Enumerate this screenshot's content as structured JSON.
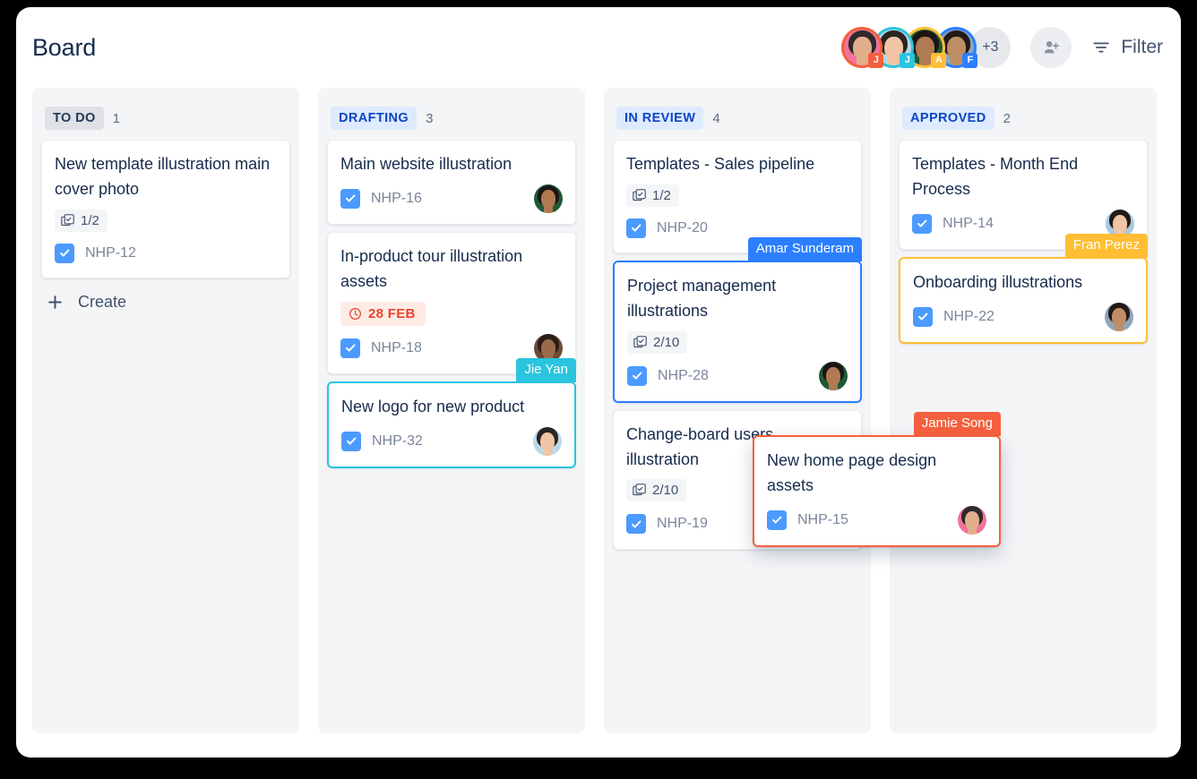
{
  "header": {
    "title": "Board",
    "overflow_count": "+3",
    "filter_label": "Filter",
    "add_person_icon": "person-add-icon",
    "filter_icon": "filter-icon",
    "avatars": [
      {
        "initial": "J",
        "ring": "#F4603E",
        "badge": "#F4603E",
        "hair": "#2E2A29",
        "skin": "#E3AE8C",
        "bg": "#F2739B"
      },
      {
        "initial": "J",
        "ring": "#2BC4DE",
        "badge": "#2BC4DE",
        "hair": "#2B2422",
        "skin": "#F0C4A4",
        "bg": "#BBD8E6"
      },
      {
        "initial": "A",
        "ring": "#FFBE33",
        "badge": "#FFBE33",
        "hair": "#1C1614",
        "skin": "#B07A53",
        "bg": "#1E5B36"
      },
      {
        "initial": "F",
        "ring": "#2B7FFF",
        "badge": "#2B7FFF",
        "hair": "#221A18",
        "skin": "#C08E66",
        "bg": "#8FA5B8"
      }
    ]
  },
  "columns": [
    {
      "name": "TO DO",
      "chip_style": "chip-todo",
      "count": "1",
      "create_label": "Create",
      "cards": [
        {
          "title": "New template illustration main cover photo",
          "subtasks": "1/2",
          "key": "NHP-12",
          "avatar": null,
          "due": null,
          "selection": null,
          "presence": null
        }
      ]
    },
    {
      "name": "DRAFTING",
      "chip_style": "chip-blue",
      "count": "3",
      "create_label": null,
      "cards": [
        {
          "title": "Main website illustration",
          "subtasks": null,
          "key": "NHP-16",
          "avatar": {
            "hair": "#1C1614",
            "skin": "#B07A53",
            "bg": "#1E5B36"
          },
          "due": null,
          "selection": null,
          "presence": null
        },
        {
          "title": "In-product tour illustration assets",
          "subtasks": null,
          "key": "NHP-18",
          "avatar": {
            "hair": "#2A1D18",
            "skin": "#9A6B48",
            "bg": "#6E4A35"
          },
          "due": "28 FEB",
          "selection": null,
          "presence": null
        },
        {
          "title": "New logo for new product",
          "subtasks": null,
          "key": "NHP-32",
          "avatar": {
            "hair": "#2B2422",
            "skin": "#F0C4A4",
            "bg": "#BBD8E6"
          },
          "due": null,
          "selection": "cyan",
          "presence": {
            "name": "Jie Yan",
            "tag_style": "tag-cyan"
          }
        }
      ]
    },
    {
      "name": "IN REVIEW",
      "chip_style": "chip-blue",
      "count": "4",
      "create_label": null,
      "cards": [
        {
          "title": "Templates - Sales pipeline",
          "subtasks": "1/2",
          "key": "NHP-20",
          "avatar": null,
          "due": null,
          "selection": null,
          "presence": null
        },
        {
          "title": "Project management illustrations",
          "subtasks": "2/10",
          "key": "NHP-28",
          "avatar": {
            "hair": "#1C1614",
            "skin": "#B07A53",
            "bg": "#1E5B36"
          },
          "due": null,
          "selection": "blue",
          "presence": {
            "name": "Amar Sunderam",
            "tag_style": "tag-blue"
          }
        },
        {
          "title": "Change-board users illustration",
          "subtasks": "2/10",
          "key": "NHP-19",
          "avatar": {
            "hair": "#1C1614",
            "skin": "#B07A53",
            "bg": "#1E5B36"
          },
          "due": null,
          "selection": null,
          "presence": null
        }
      ]
    },
    {
      "name": "APPROVED",
      "chip_style": "chip-blue",
      "count": "2",
      "create_label": null,
      "cards": [
        {
          "title": "Templates - Month End Process",
          "subtasks": null,
          "key": "NHP-14",
          "avatar": {
            "hair": "#211A18",
            "skin": "#F0C4A4",
            "bg": "#A9CBDC"
          },
          "due": null,
          "selection": null,
          "presence": null
        },
        {
          "title": "Onboarding illustrations",
          "subtasks": null,
          "key": "NHP-22",
          "avatar": {
            "hair": "#231917",
            "skin": "#C08E66",
            "bg": "#8FA5B8"
          },
          "due": null,
          "selection": "yellow",
          "presence": {
            "name": "Fran Perez",
            "tag_style": "tag-yellow"
          }
        }
      ]
    }
  ],
  "floating_card": {
    "title": "New home page design assets",
    "key": "NHP-15",
    "presence": {
      "name": "Jamie Song",
      "tag_style": "tag-orange"
    },
    "avatar": {
      "hair": "#2E2A29",
      "skin": "#E3AE8C",
      "bg": "#F2739B"
    }
  },
  "colors": {
    "page_bg": "#000000",
    "surface": "#ffffff",
    "column_bg": "#F4F5F7",
    "text_primary": "#172B4D",
    "text_muted": "#7A869A",
    "checkbox_blue": "#4C9AFF",
    "chip_blue_bg": "#DEEBFF",
    "chip_blue_fg": "#0B46C2",
    "due_bg": "#FFEBE6",
    "due_fg": "#E8452B"
  }
}
